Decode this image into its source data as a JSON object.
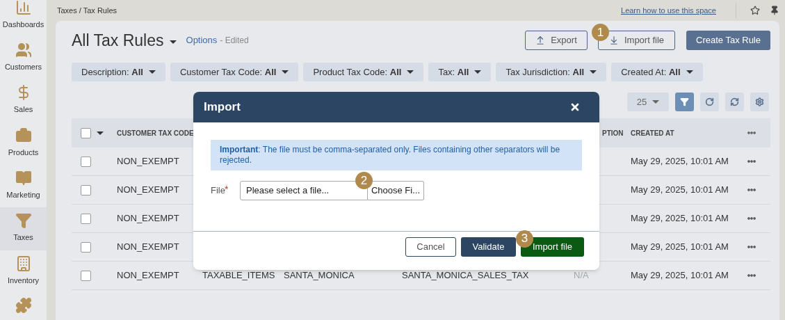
{
  "sidebar": {
    "items": [
      {
        "label": "Dashboards",
        "selected": false
      },
      {
        "label": "Customers",
        "selected": false
      },
      {
        "label": "Sales",
        "selected": false
      },
      {
        "label": "Products",
        "selected": false
      },
      {
        "label": "Marketing",
        "selected": false
      },
      {
        "label": "Taxes",
        "selected": true
      },
      {
        "label": "Inventory",
        "selected": false
      }
    ]
  },
  "top_bar": {
    "breadcrumb": "Taxes / Tax Rules",
    "help_link": "Learn how to use this space"
  },
  "header": {
    "title": "All Tax Rules",
    "options": "Options",
    "edited": "- Edited",
    "export": "Export",
    "import": "Import file",
    "create": "Create Tax Rule"
  },
  "filters": [
    {
      "label": "Description:",
      "value": "All"
    },
    {
      "label": "Customer Tax Code:",
      "value": "All"
    },
    {
      "label": "Product Tax Code:",
      "value": "All"
    },
    {
      "label": "Tax:",
      "value": "All"
    },
    {
      "label": "Tax Jurisdiction:",
      "value": "All"
    },
    {
      "label": "Created At:",
      "value": "All"
    }
  ],
  "toolbar": {
    "page_size": "25",
    "filter_on": true
  },
  "table": {
    "select_all": false,
    "columns": [
      "CUSTOMER TAX CODE",
      "",
      "",
      "",
      "PTION",
      "CREATED AT"
    ],
    "rows": [
      {
        "checked": false,
        "cells": [
          "NON_EXEMPT",
          "",
          "",
          "",
          "",
          "May 29, 2025, 10:01 AM"
        ]
      },
      {
        "checked": false,
        "cells": [
          "NON_EXEMPT",
          "",
          "",
          "",
          "",
          "May 29, 2025, 10:01 AM"
        ]
      },
      {
        "checked": false,
        "cells": [
          "NON_EXEMPT",
          "",
          "",
          "",
          "",
          "May 29, 2025, 10:01 AM"
        ]
      },
      {
        "checked": false,
        "cells": [
          "NON_EXEMPT",
          "",
          "",
          "",
          "",
          "May 29, 2025, 10:01 AM"
        ]
      },
      {
        "checked": false,
        "cells": [
          "NON_EXEMPT",
          "TAXABLE_ITEMS",
          "SANTA_MONICA",
          "SANTA_MONICA_SALES_TAX",
          "N/A",
          "May 29, 2025, 10:01 AM"
        ]
      }
    ]
  },
  "modal": {
    "title": "Import",
    "notice": "**Important**: The file must be comma-separated only. Files containing other separators will be rejected.",
    "file_label": "File",
    "required": "*",
    "file_placeholder": "Please select a file...",
    "choose": "Choose Fi...",
    "cancel": "Cancel",
    "validate": "Validate",
    "import": "Import file"
  },
  "steps": [
    "1",
    "2",
    "3"
  ]
}
